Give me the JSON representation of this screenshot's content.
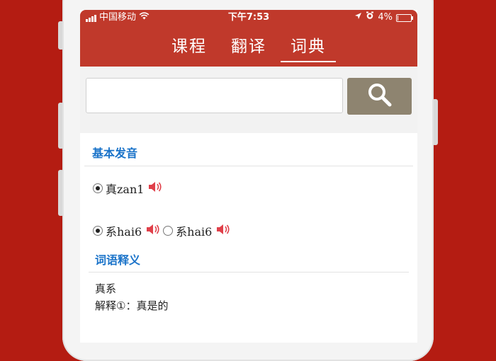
{
  "status_bar": {
    "carrier": "中国移动",
    "time": "下午7:53",
    "battery": "4%",
    "battery_level": 0.04
  },
  "tabs": [
    {
      "label": "课程",
      "active": false
    },
    {
      "label": "翻译",
      "active": false
    },
    {
      "label": "词典",
      "active": true
    }
  ],
  "search": {
    "value": "",
    "placeholder": ""
  },
  "pronunciation": {
    "title": "基本发音",
    "rows": [
      {
        "options": [
          {
            "label": "真zan1",
            "selected": true
          }
        ]
      },
      {
        "options": [
          {
            "label": "系hai6",
            "selected": true
          },
          {
            "label": "系hai6",
            "selected": false
          }
        ]
      }
    ]
  },
  "definition": {
    "title": "词语释义",
    "word": "真系",
    "meaning": "解释①：真是的"
  },
  "colors": {
    "background": "#b41c12",
    "header": "#c0392b",
    "search_button": "#8e8470",
    "link_blue": "#1a73c9",
    "speaker": "#e0404a"
  },
  "icons": [
    "signal-bars-icon",
    "wifi-icon",
    "location-icon",
    "alarm-icon",
    "battery-icon",
    "search-icon",
    "speaker-icon"
  ]
}
